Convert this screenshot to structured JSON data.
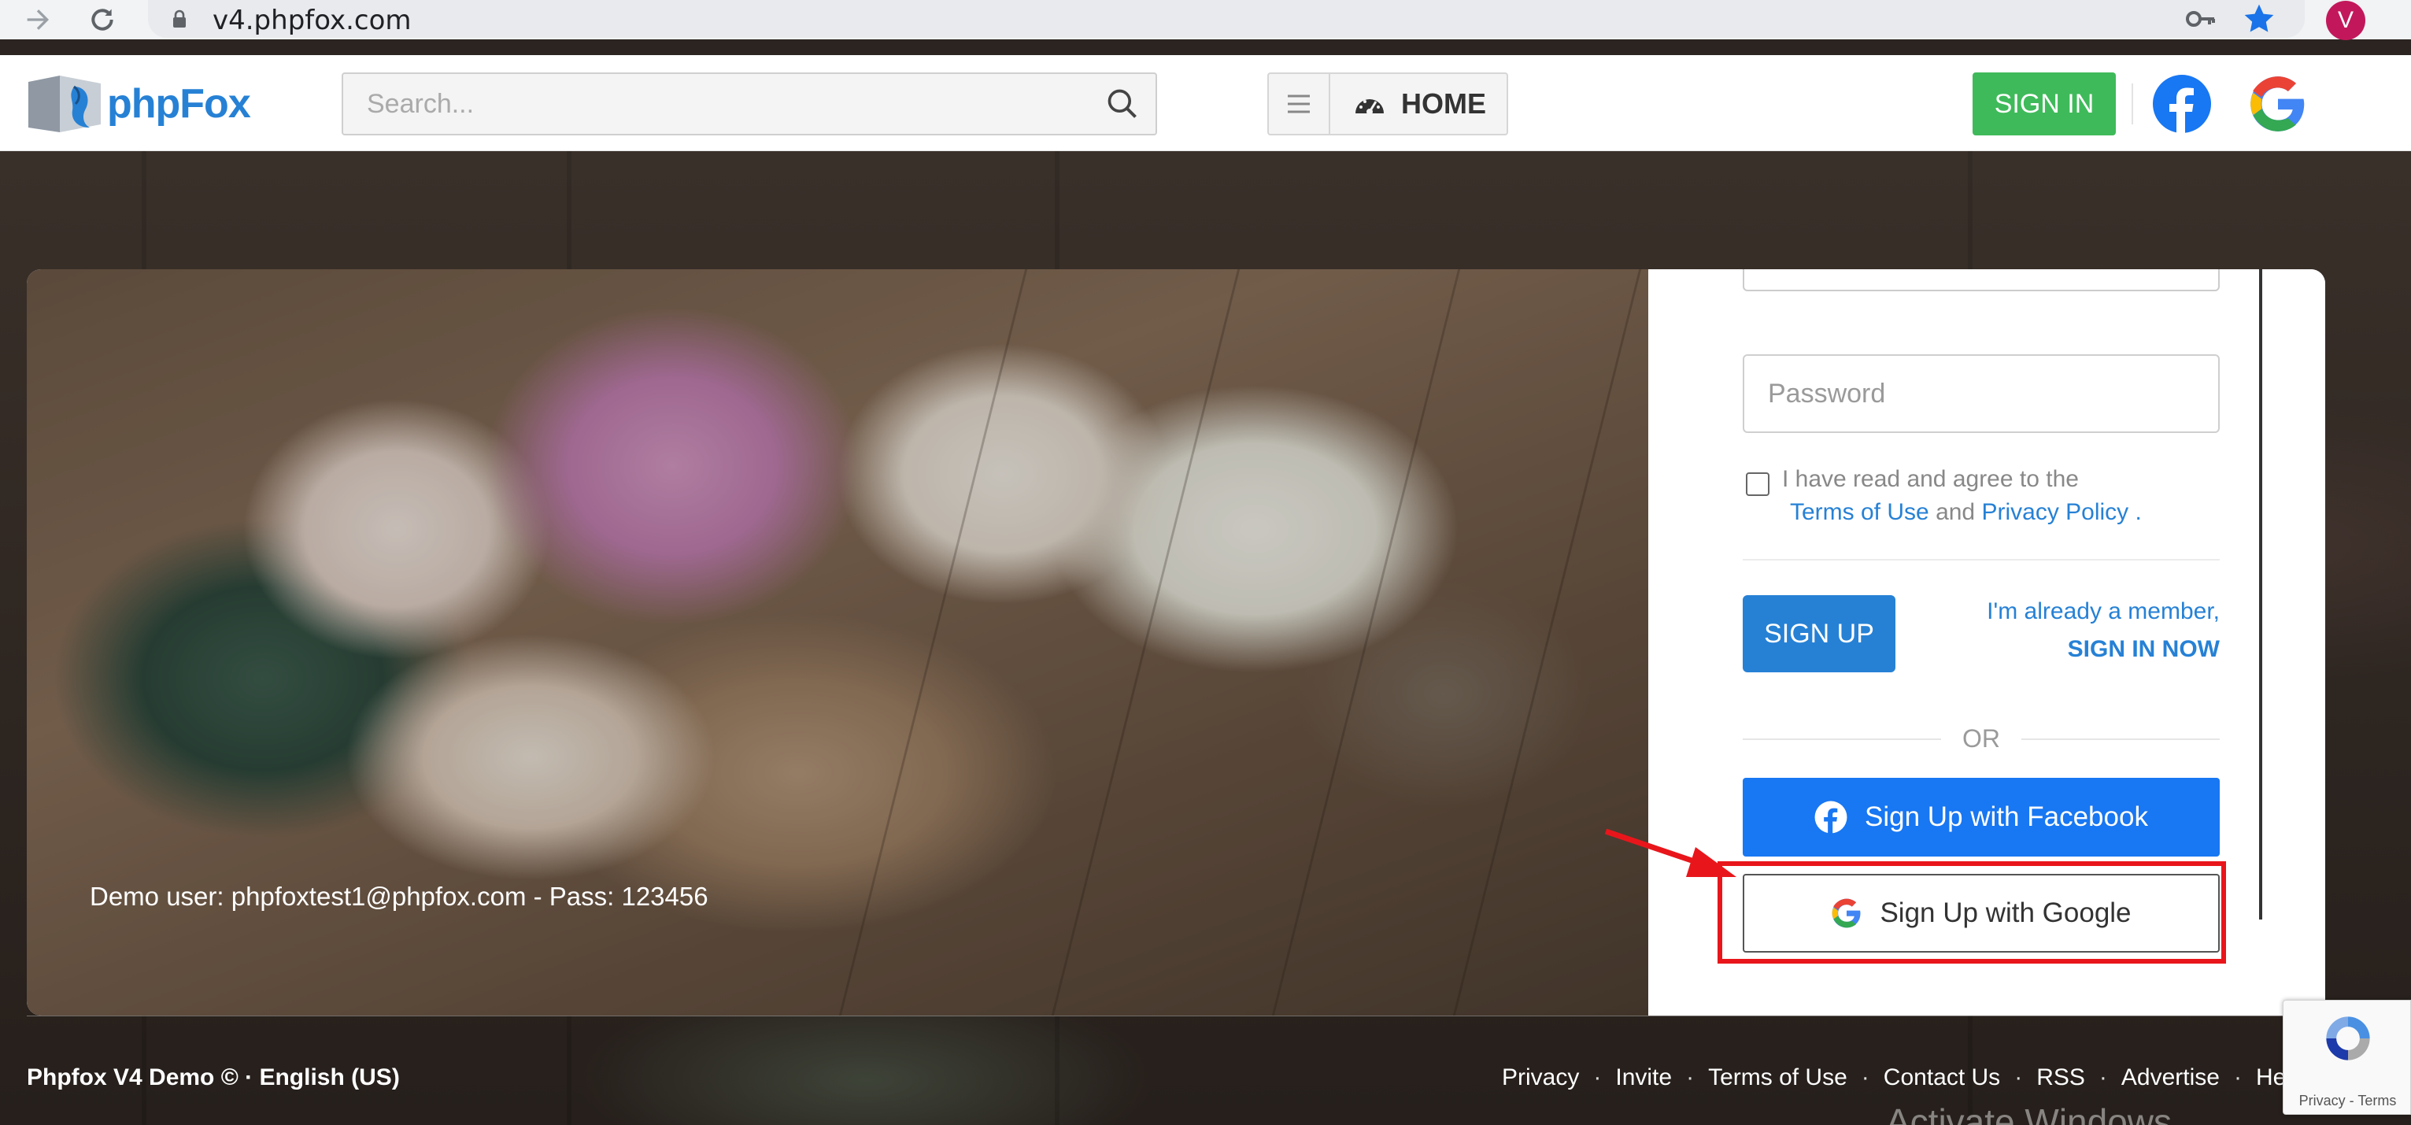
{
  "browser": {
    "url": "v4.phpfox.com",
    "profile_initial": "V"
  },
  "header": {
    "logo_text": "phpFox",
    "search_placeholder": "Search...",
    "home_label": "HOME",
    "signin_label": "SIGN IN"
  },
  "hero": {
    "demo_note": "Demo user: phpfoxtest1@phpfox.com - Pass: 123456"
  },
  "form": {
    "password_placeholder": "Password",
    "terms_prefix": "I have read and agree to the",
    "terms_link": "Terms of Use",
    "terms_and": "and",
    "privacy_link": "Privacy Policy",
    "terms_suffix": ".",
    "signup_label": "SIGN UP",
    "member_text": "I'm already a member,",
    "signin_now": "SIGN IN NOW",
    "or_text": "OR",
    "facebook_label": "Sign Up with Facebook",
    "google_label": "Sign Up with Google"
  },
  "footer": {
    "left": "Phpfox V4 Demo © · English (US)",
    "links": [
      "Privacy",
      "Invite",
      "Terms of Use",
      "Contact Us",
      "RSS",
      "Advertise",
      "He"
    ],
    "activate": "Activate Windows",
    "recaptcha_links": "Privacy - Terms"
  },
  "colors": {
    "brand_blue": "#2681d5",
    "signin_green": "#3fba5a",
    "facebook_blue": "#1877f2",
    "highlight_red": "#e8161b"
  }
}
